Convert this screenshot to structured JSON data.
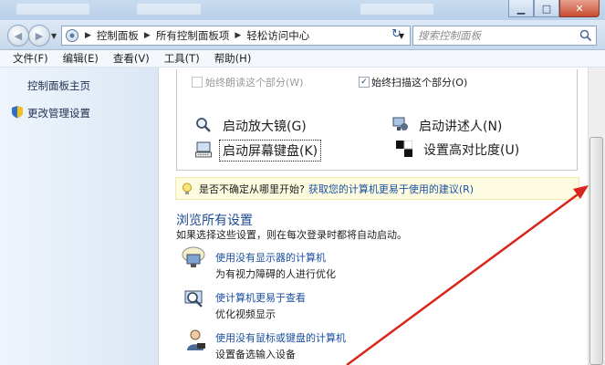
{
  "address": {
    "breadcrumb": [
      "控制面板",
      "所有控制面板项",
      "轻松访问中心"
    ]
  },
  "search": {
    "placeholder": "搜索控制面板"
  },
  "menu": [
    "文件(F)",
    "编辑(E)",
    "查看(V)",
    "工具(T)",
    "帮助(H)"
  ],
  "sidebar": {
    "items": [
      {
        "label": "控制面板主页"
      },
      {
        "label": "更改管理设置"
      }
    ]
  },
  "quick_access": {
    "options": [
      {
        "label": "始终朗读这个部分(W)",
        "checked": false,
        "enabled": false
      },
      {
        "label": "始终扫描这个部分(O)",
        "checked": true,
        "enabled": true
      }
    ],
    "tools": [
      {
        "label": "启动放大镜(G)",
        "icon": "magnifier-icon"
      },
      {
        "label": "启动讲述人(N)",
        "icon": "narrator-icon"
      },
      {
        "label": "启动屏幕键盘(K)",
        "icon": "on-screen-keyboard-icon"
      },
      {
        "label": "设置高对比度(U)",
        "icon": "high-contrast-icon"
      }
    ]
  },
  "info_bar": {
    "text": "是否不确定从哪里开始?",
    "link": "获取您的计算机更易于使用的建议(R)"
  },
  "browse": {
    "title": "浏览所有设置",
    "description": "如果选择这些设置，则在每次登录时都将自动启动。",
    "items": [
      {
        "link": "使用没有显示器的计算机",
        "desc": "为有视力障碍的人进行优化",
        "icon": "no-display-icon"
      },
      {
        "link": "使计算机更易于查看",
        "desc": "优化视频显示",
        "icon": "display-magnify-icon"
      },
      {
        "link": "使用没有鼠标或键盘的计算机",
        "desc": "设置备选输入设备",
        "icon": "user-input-icon"
      }
    ]
  },
  "colors": {
    "accent_link": "#1a4fa0",
    "section_title": "#1d4a8f",
    "annotation_arrow": "#d9261c",
    "info_bar_bg": "#fefce0"
  }
}
